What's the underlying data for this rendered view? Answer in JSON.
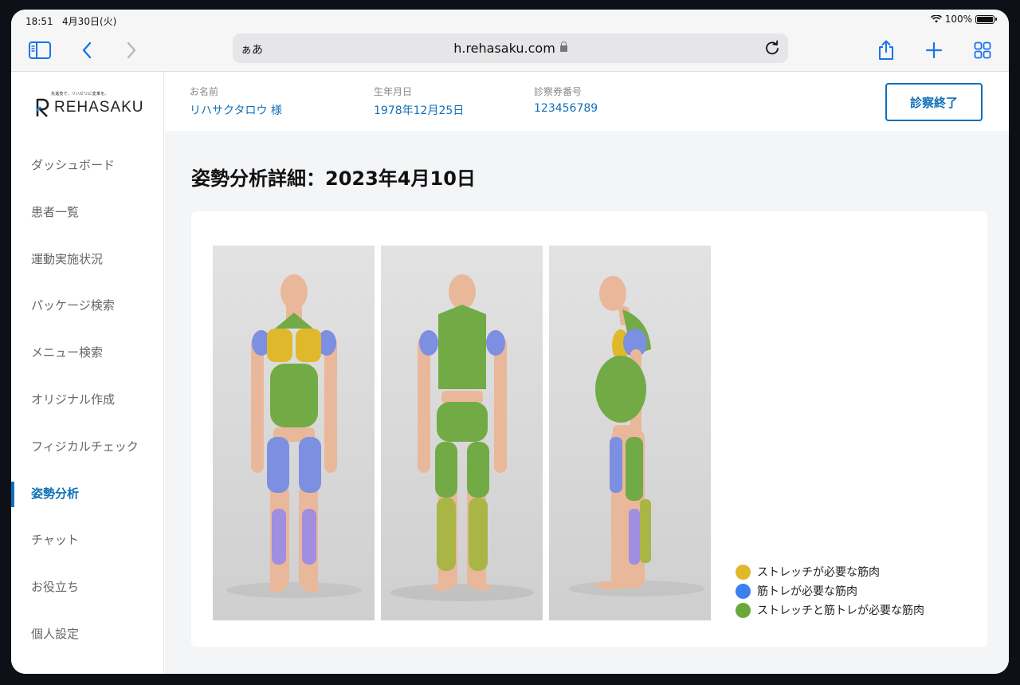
{
  "status_bar": {
    "time": "18:51",
    "date": "4月30日(火)",
    "battery": "100%"
  },
  "browser": {
    "aa_label": "ぁあ",
    "url": "h.rehasaku.com"
  },
  "logo": {
    "tagline": "先進技で、リハビリに変革を。",
    "name": "REHASAKU"
  },
  "sidebar": {
    "items": [
      {
        "label": "ダッシュボード"
      },
      {
        "label": "患者一覧"
      },
      {
        "label": "運動実施状況"
      },
      {
        "label": "パッケージ検索"
      },
      {
        "label": "メニュー検索"
      },
      {
        "label": "オリジナル作成"
      },
      {
        "label": "フィジカルチェック"
      },
      {
        "label": "姿勢分析",
        "active": true
      },
      {
        "label": "チャット"
      },
      {
        "label": "お役立ち"
      },
      {
        "label": "個人設定"
      }
    ]
  },
  "patient": {
    "name_label": "お名前",
    "name": "リハサクタロウ 様",
    "dob_label": "生年月日",
    "dob": "1978年12月25日",
    "card_label": "診察券番号",
    "card_no": "123456789"
  },
  "header": {
    "end_button": "診察終了"
  },
  "main": {
    "title": "姿勢分析詳細：2023年4月10日"
  },
  "views": [
    {
      "name": "front-view"
    },
    {
      "name": "back-view"
    },
    {
      "name": "side-view"
    }
  ],
  "legend": [
    {
      "label": "ストレッチが必要な筋肉",
      "color": "#e0b82c"
    },
    {
      "label": "筋トレが必要な筋肉",
      "color": "#3b7ff0"
    },
    {
      "label": "ストレッチと筋トレが必要な筋肉",
      "color": "#6aa839"
    }
  ],
  "colors": {
    "accent": "#0f6fb8",
    "skin": "#e9b89a",
    "stretch": "#e0b82c",
    "strength": "#7d8fe0",
    "both": "#72ab45"
  }
}
